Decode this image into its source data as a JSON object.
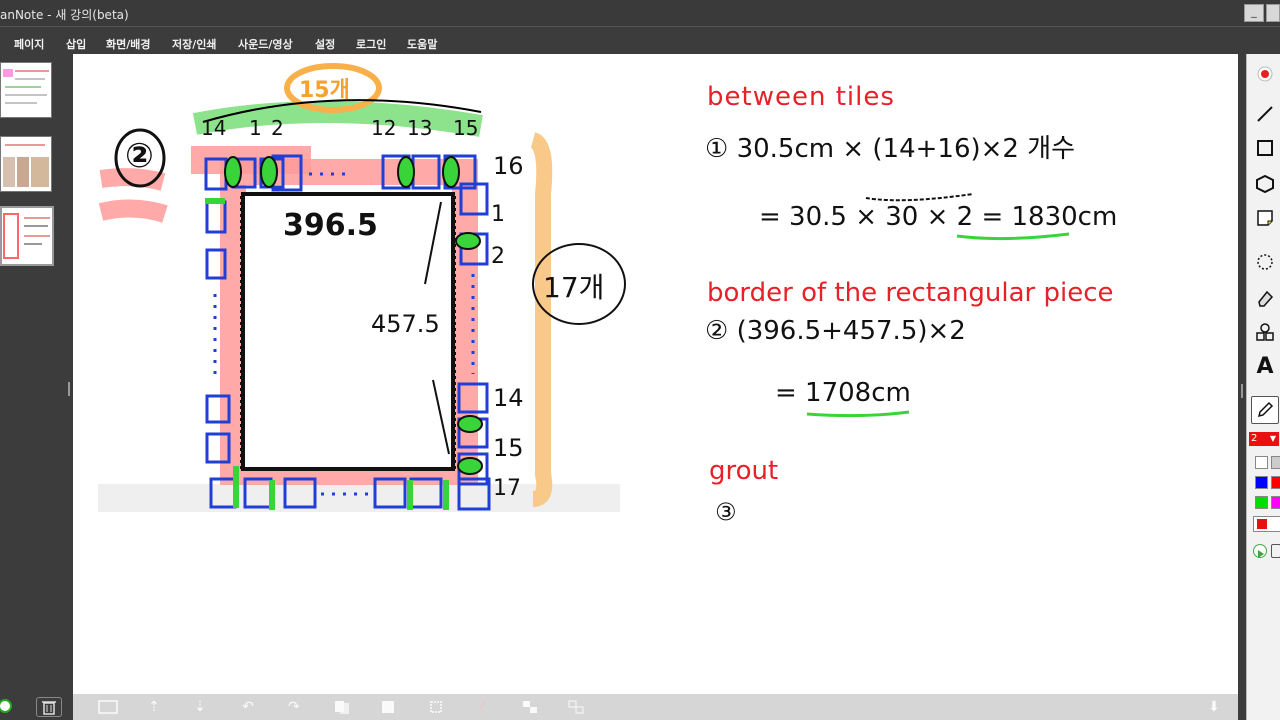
{
  "window": {
    "title": "anNote - 새 강의(beta)",
    "minimize": "_"
  },
  "menu": [
    "페이지",
    "삽입",
    "화면/배경",
    "저장/인쇄",
    "사운드/영상",
    "설정",
    "로그인",
    "도움말"
  ],
  "slides": [
    "slide-1",
    "slide-2",
    "slide-3"
  ],
  "canvas": {
    "drawing": {
      "circled_num": "②",
      "top_label": "15개",
      "top_nums": [
        "14",
        "1",
        "2",
        "12",
        "13",
        "15"
      ],
      "right_nums_top": [
        "16",
        "1",
        "2"
      ],
      "right_nums_bottom": [
        "14",
        "15",
        "17"
      ],
      "side_label": "17개",
      "width_value": "396.5",
      "height_value": "457.5"
    },
    "notes": {
      "heading1": "between tiles",
      "line1": "① 30.5cm × (14+16)×2 개수",
      "line1_result": "= 30.5 × 30 × 2 = 1830cm",
      "heading2": "border of the rectangular piece",
      "line2": "② (396.5+457.5)×2",
      "line2_result": "= 1708cm",
      "heading3": "grout",
      "line3": "③"
    }
  },
  "tools": [
    "record-icon",
    "line-icon",
    "rectangle-icon",
    "hexagon-icon",
    "sticky-note-icon",
    "lasso-icon",
    "eraser-icon",
    "shapes-icon",
    "text-icon",
    "pen-icon"
  ],
  "pen": {
    "size": "2",
    "color": "#ff0000"
  },
  "palette": [
    "#ffffff",
    "#cccccc",
    "#0000ff",
    "#ff0000",
    "#00dd00",
    "#ff00ff"
  ],
  "colors": {
    "accent_red": "#e8202a",
    "tile_blue": "#1f3fd6",
    "highlight_red": "#ff9a9a",
    "highlight_green": "#39d43a",
    "highlight_orange": "#f9c98a"
  }
}
